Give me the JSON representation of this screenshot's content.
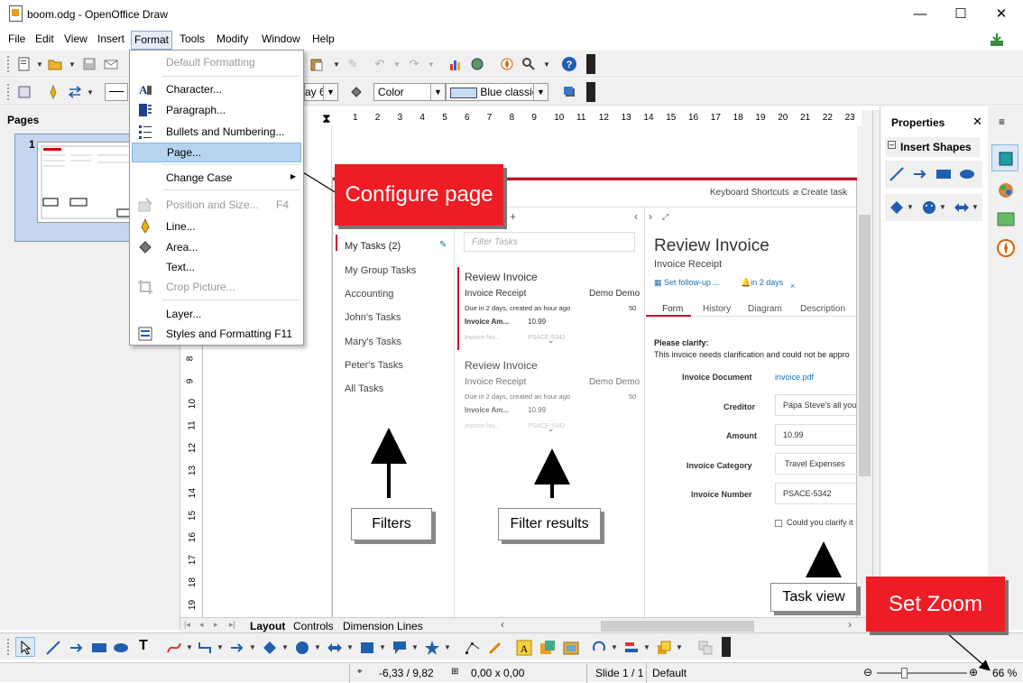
{
  "window": {
    "title": "boom.odg - OpenOffice Draw",
    "minimize": "—",
    "maximize": "☐",
    "close": "✕"
  },
  "menu": [
    "File",
    "Edit",
    "View",
    "Insert",
    "Format",
    "Tools",
    "Modify",
    "Window",
    "Help"
  ],
  "format_toolbar": {
    "font_size": "ay 6",
    "area_style": "Color",
    "area_value": "Blue classic"
  },
  "pages_pane": {
    "title": "Pages",
    "thumb_number": "1"
  },
  "ruler": {
    "h_ticks": [
      "1",
      "2",
      "3",
      "4",
      "5",
      "6",
      "7",
      "8",
      "9",
      "10",
      "11",
      "12",
      "13",
      "14",
      "15",
      "16",
      "17",
      "18",
      "19",
      "20",
      "21",
      "22",
      "23"
    ],
    "v_ticks": [
      "8",
      "9",
      "10",
      "11",
      "12",
      "13",
      "14",
      "15",
      "16",
      "17",
      "18",
      "19"
    ]
  },
  "format_menu": {
    "items": [
      {
        "label": "Default Formatting",
        "disabled": true
      },
      {
        "label": "Character...",
        "disabled": false
      },
      {
        "label": "Paragraph...",
        "disabled": false
      },
      {
        "label": "Bullets and Numbering...",
        "disabled": false
      },
      {
        "label": "Page...",
        "disabled": false,
        "highlighted": true
      },
      {
        "label": "Change Case",
        "disabled": false,
        "submenu": true
      },
      {
        "label": "Position and Size...",
        "disabled": true,
        "shortcut": "F4"
      },
      {
        "label": "Line...",
        "disabled": false
      },
      {
        "label": "Area...",
        "disabled": false
      },
      {
        "label": "Text...",
        "disabled": false
      },
      {
        "label": "Crop Picture...",
        "disabled": true
      },
      {
        "label": "Layer...",
        "disabled": false
      },
      {
        "label": "Styles and Formatting",
        "disabled": false,
        "shortcut": "F11"
      }
    ]
  },
  "callouts": {
    "configure_page": "Configure page",
    "set_zoom": "Set Zoom"
  },
  "labels": {
    "filters": "Filters",
    "filter_results": "Filter results",
    "task_view": "Task view"
  },
  "embedded_app": {
    "header_links": [
      "Keyboard Shortcuts",
      "Create task"
    ],
    "filters": [
      "My Tasks (2)",
      "My Group Tasks",
      "Accounting",
      "John's Tasks",
      "Mary's Tasks",
      "Peter's Tasks",
      "All Tasks"
    ],
    "filter_placeholder": "Filter Tasks",
    "tasks": [
      {
        "title": "Review Invoice",
        "subtitle": "Invoice Receipt",
        "owner": "Demo Demo",
        "due": "Due in 2 days, created an hour ago",
        "prio": "50",
        "field": "Invoice Am...",
        "value": "10.99",
        "field2": "Invoice Nu...",
        "value2": "PSACE-5342"
      },
      {
        "title": "Review Invoice",
        "subtitle": "Invoice Receipt",
        "owner": "Demo Demo",
        "due": "Due in 2 days, created an hour ago",
        "prio": "50",
        "field": "Invoice Am...",
        "value": "10.99",
        "field2": "Invoice Nu...",
        "value2": "PSACE-5342"
      }
    ],
    "detail": {
      "title": "Review Invoice",
      "subtitle": "Invoice Receipt",
      "followup": "Set follow-up ...",
      "due": "in 2 days",
      "tabs": [
        "Form",
        "History",
        "Diagram",
        "Description"
      ],
      "clarify_head": "Please clarify:",
      "clarify_text": "This invoice needs clarification and could not be appro",
      "fields": [
        {
          "label": "Invoice Document",
          "value": "invoice.pdf"
        },
        {
          "label": "Creditor",
          "value": "Papa Steve's all you"
        },
        {
          "label": "Amount",
          "value": "10.99"
        },
        {
          "label": "Invoice Category",
          "value": "Travel Expenses"
        },
        {
          "label": "Invoice Number",
          "value": "PSACE-5342"
        }
      ],
      "checkbox": "Could you clarify it"
    }
  },
  "sheet_tabs": [
    "Layout",
    "Controls",
    "Dimension Lines"
  ],
  "properties": {
    "title": "Properties",
    "section": "Insert Shapes"
  },
  "status": {
    "position": "-6,33 / 9,82",
    "size": "0,00 x 0,00",
    "slide": "Slide 1 / 1",
    "layout": "Default",
    "zoom": "66 %"
  },
  "colors": {
    "callout": "#ee1c25",
    "highlight": "#b6d4f0",
    "accent_red": "#c8102e",
    "link_blue": "#1a6fb3"
  }
}
